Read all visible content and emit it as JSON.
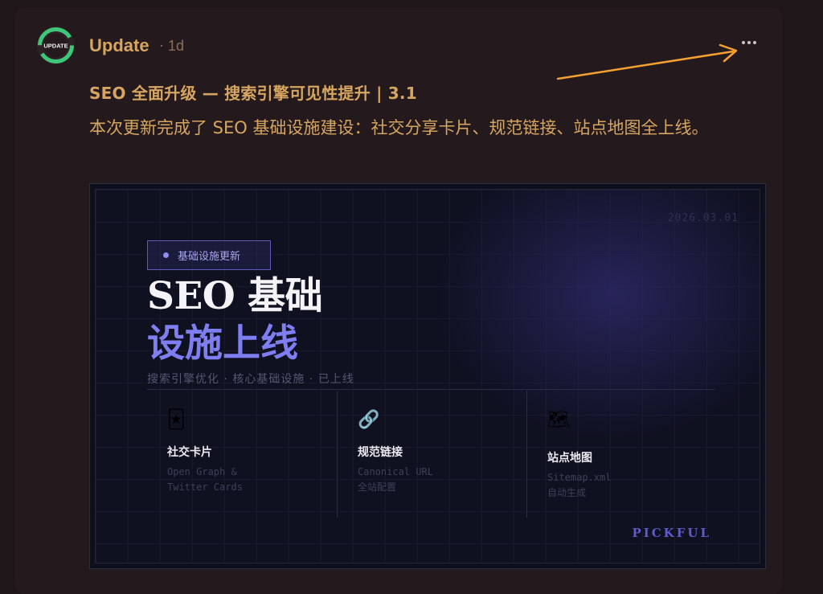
{
  "post": {
    "author": "Update",
    "separator": "·",
    "time": "1d",
    "avatar_text": "UPDATE",
    "more_icon": "ellipsis-icon",
    "title": "SEO 全面升级 — 搜索引擎可见性提升 | 3.1",
    "body": "本次更新完成了 SEO 基础设施建设：社交分享卡片、规范链接、站点地图全上线。"
  },
  "hero": {
    "date": "2026.03.01",
    "badge": "基础设施更新",
    "headline_line1": "SEO 基础",
    "headline_line2": "设施上线",
    "subtitle": "搜索引擎优化 · 核心基础设施 · 已上线",
    "features": [
      {
        "icon": "🃏",
        "title": "社交卡片",
        "desc": "Open Graph &\nTwitter Cards"
      },
      {
        "icon": "🔗",
        "title": "规范链接",
        "desc": "Canonical URL\n全站配置"
      },
      {
        "icon": "🗺",
        "title": "站点地图",
        "desc": "Sitemap.xml\n自动生成"
      }
    ],
    "brand": "PICKFUL"
  },
  "colors": {
    "accent": "#d6a661",
    "avatar_green": "#3ec77a",
    "hero_purple": "#7f7ef0",
    "annotation_arrow": "#f5a030"
  }
}
